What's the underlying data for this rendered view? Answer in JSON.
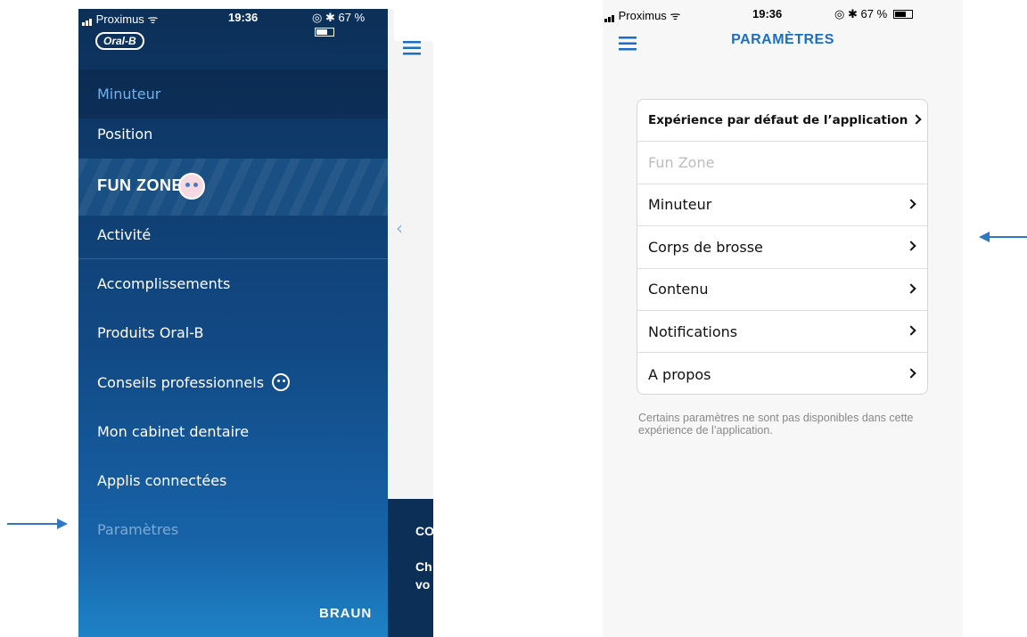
{
  "colors": {
    "menu_bg_top": "#0c2f57",
    "menu_bg_bottom": "#1f82c6",
    "menu_active_text": "#6fb3ee",
    "accent_blue": "#1a6fc4",
    "arrow_blue": "#2f78c4",
    "settings_bg": "#f7f7f7"
  },
  "left_screen": {
    "status_bar": {
      "carrier": "Proximus",
      "time": "19:36",
      "battery": "67 %"
    },
    "logo": "Oral-B",
    "menu": {
      "minuteur": "Minuteur",
      "position": "Position",
      "funzone": "FUN ZONE",
      "activite": "Activité",
      "accomplissements": "Accomplissements",
      "produits": "Produits Oral-B",
      "conseils": "Conseils professionnels",
      "cabinet": "Mon cabinet dentaire",
      "applis": "Applis connectées",
      "parametres": "Paramètres"
    },
    "brand_footer": "BRAUN",
    "peek_text_1": "CO",
    "peek_text_2": "Ch",
    "peek_text_3": "vo"
  },
  "right_screen": {
    "status_bar": {
      "carrier": "Proximus",
      "time": "19:36",
      "battery": "67 %"
    },
    "title": "PARAMÈTRES",
    "settings": {
      "experience": "Expérience par défaut de l’application",
      "funzone": "Fun Zone",
      "minuteur": "Minuteur",
      "corps": "Corps de brosse",
      "contenu": "Contenu",
      "notifications": "Notifications",
      "apropos": "A propos"
    },
    "note": "Certains paramètres ne sont pas disponibles dans cette expérience de l’application."
  }
}
